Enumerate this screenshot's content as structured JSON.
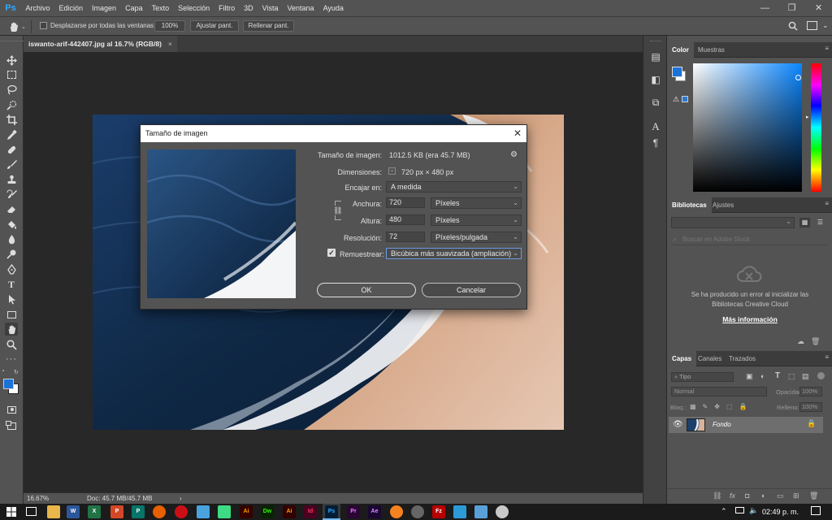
{
  "app": {
    "logo": "Ps"
  },
  "menu": [
    "Archivo",
    "Edición",
    "Imagen",
    "Capa",
    "Texto",
    "Selección",
    "Filtro",
    "3D",
    "Vista",
    "Ventana",
    "Ayuda"
  ],
  "window_controls": [
    "—",
    "❐",
    "✕"
  ],
  "options": {
    "scroll_all_label": "Desplazarse por todas las ventanas",
    "zoom_btn": "100%",
    "fit_btn": "Ajustar pant.",
    "fill_btn": "Rellenar pant."
  },
  "document": {
    "tab_title": "iswanto-arif-442407.jpg al 16.7% (RGB/8)",
    "tab_close": "×",
    "zoom": "16.67%",
    "doc_info": "Doc: 45.7 MB/45.7 MB",
    "status_arrow": "›"
  },
  "dialog": {
    "title": "Tamaño de imagen",
    "close": "✕",
    "size_label": "Tamaño de imagen:",
    "size_value": "1012.5 KB (era 45.7 MB)",
    "dim_label": "Dimensiones:",
    "dim_value": "720 px × 480 px",
    "fit_label": "Encajar en:",
    "fit_value": "A medida",
    "width_label": "Anchura:",
    "width_value": "720",
    "width_unit": "Píxeles",
    "height_label": "Altura:",
    "height_value": "480",
    "height_unit": "Píxeles",
    "res_label": "Resolución:",
    "res_value": "72",
    "res_unit": "Píxeles/pulgada",
    "resample_label": "Remuestrear:",
    "resample_value": "Bicúbica más suavizada (ampliación)",
    "ok": "OK",
    "cancel": "Cancelar",
    "checkmark": "✓"
  },
  "panels": {
    "color_tabs": [
      "Color",
      "Muestras"
    ],
    "library_tabs": [
      "Bibliotecas",
      "Ajustes"
    ],
    "library_search_placeholder": "Buscar en Adobe Stock",
    "library_error": "Se ha producido un error al inicializar las Bibliotecas Creative Cloud",
    "library_more": "Más información",
    "layers_tabs": [
      "Capas",
      "Canales",
      "Trazados"
    ],
    "layers_kind": "Tipo",
    "blend_mode": "Normal",
    "opacity_label": "Opacidad:",
    "opacity_value": "100%",
    "lock_label": "Bloq.:",
    "fill_label": "Relleno:",
    "fill_value": "100%",
    "layer_name": "Fondo"
  },
  "taskbar": {
    "clock": "02:49 p. m.",
    "apps": [
      "W",
      "X",
      "P",
      "P",
      "Ai",
      "Dw",
      "Ai",
      "Id",
      "Ps",
      "Pr",
      "Ae",
      "Fz"
    ]
  },
  "colors": {
    "accent": "#31a8ff",
    "foreground": "#1a73d9",
    "background": "#ffffff"
  }
}
